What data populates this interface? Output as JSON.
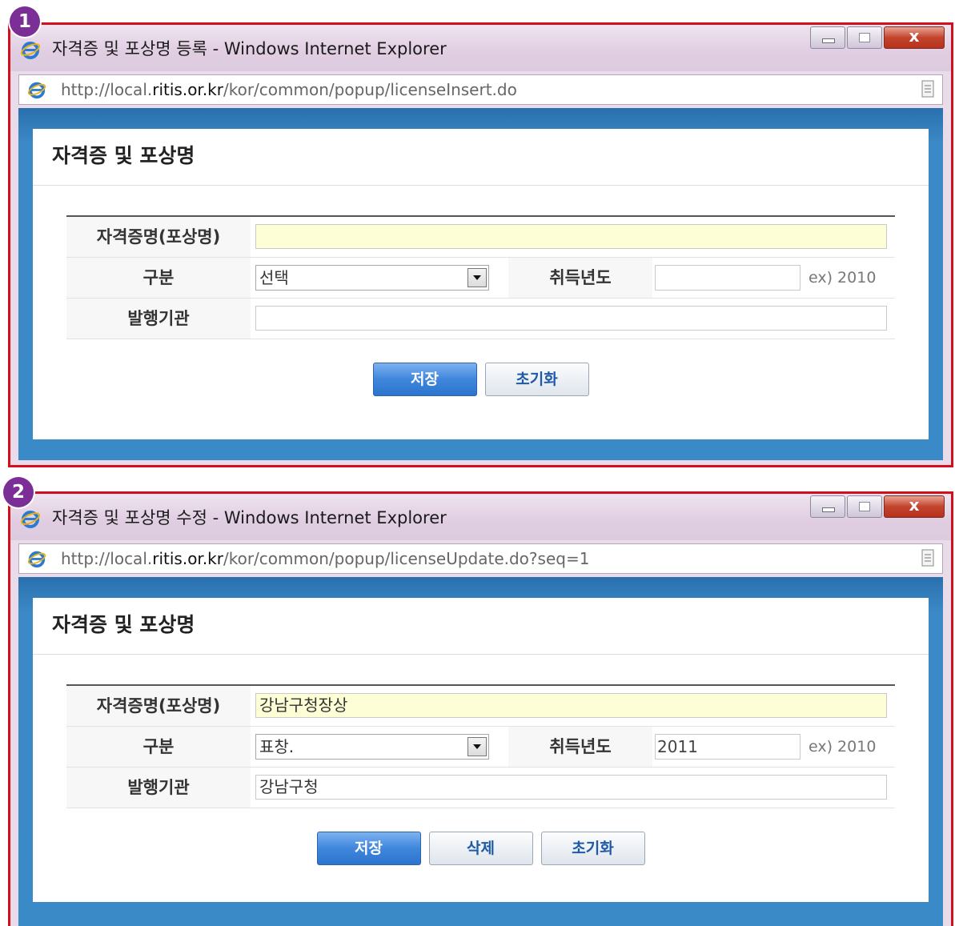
{
  "steps": [
    {
      "badge": "1",
      "window_title": "자격증 및 포상명 등록 - Windows Internet Explorer",
      "address": {
        "prefix": "http://local.",
        "host": "ritis.or.kr",
        "path": "/kor/common/popup/licenseInsert.do"
      },
      "dialog_title": "자격증 및 포상명",
      "form": {
        "name_label": "자격증명(포상명)",
        "name_value": "",
        "category_label": "구분",
        "category_value": "선택",
        "year_label": "취득년도",
        "year_value": "",
        "year_hint": "ex) 2010",
        "issuer_label": "발행기관",
        "issuer_value": ""
      },
      "buttons": {
        "save": "저장",
        "reset": "초기화"
      }
    },
    {
      "badge": "2",
      "window_title": "자격증 및 포상명 수정 - Windows Internet Explorer",
      "address": {
        "prefix": "http://local.",
        "host": "ritis.or.kr",
        "path": "/kor/common/popup/licenseUpdate.do?seq=1"
      },
      "dialog_title": "자격증 및 포상명",
      "form": {
        "name_label": "자격증명(포상명)",
        "name_value": "강남구청장상",
        "category_label": "구분",
        "category_value": "표창.",
        "year_label": "취득년도",
        "year_value": "2011",
        "year_hint": "ex) 2010",
        "issuer_label": "발행기관",
        "issuer_value": "강남구청"
      },
      "buttons": {
        "save": "저장",
        "delete": "삭제",
        "reset": "초기화"
      }
    }
  ],
  "window_controls": {
    "close_glyph": "x"
  },
  "colors": {
    "highlight_border": "#d0101c",
    "badge": "#7b2f96",
    "frame_blue": "#3b8ac8",
    "primary_button": "#3f86dc"
  }
}
